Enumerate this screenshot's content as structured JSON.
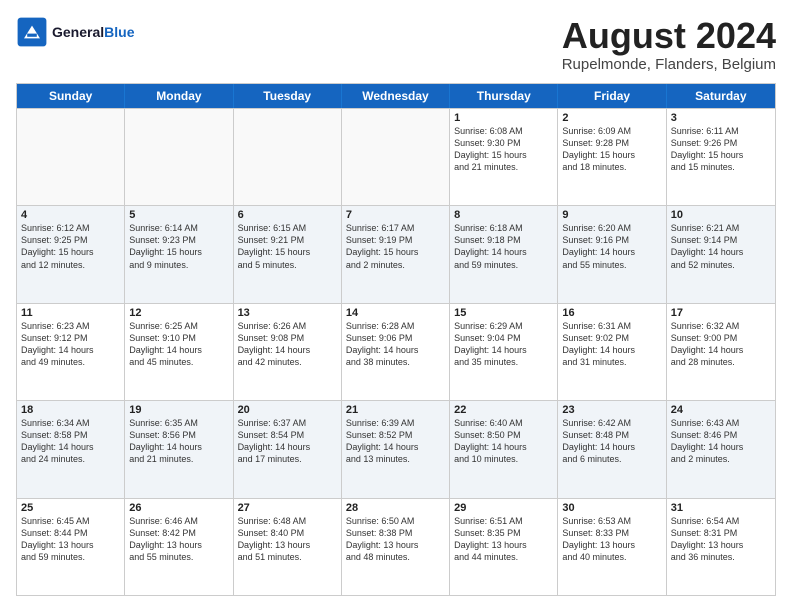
{
  "header": {
    "logo_line1": "General",
    "logo_line2": "Blue",
    "month_title": "August 2024",
    "subtitle": "Rupelmonde, Flanders, Belgium"
  },
  "days": [
    "Sunday",
    "Monday",
    "Tuesday",
    "Wednesday",
    "Thursday",
    "Friday",
    "Saturday"
  ],
  "rows": [
    [
      {
        "day": "",
        "text": ""
      },
      {
        "day": "",
        "text": ""
      },
      {
        "day": "",
        "text": ""
      },
      {
        "day": "",
        "text": ""
      },
      {
        "day": "1",
        "text": "Sunrise: 6:08 AM\nSunset: 9:30 PM\nDaylight: 15 hours\nand 21 minutes."
      },
      {
        "day": "2",
        "text": "Sunrise: 6:09 AM\nSunset: 9:28 PM\nDaylight: 15 hours\nand 18 minutes."
      },
      {
        "day": "3",
        "text": "Sunrise: 6:11 AM\nSunset: 9:26 PM\nDaylight: 15 hours\nand 15 minutes."
      }
    ],
    [
      {
        "day": "4",
        "text": "Sunrise: 6:12 AM\nSunset: 9:25 PM\nDaylight: 15 hours\nand 12 minutes."
      },
      {
        "day": "5",
        "text": "Sunrise: 6:14 AM\nSunset: 9:23 PM\nDaylight: 15 hours\nand 9 minutes."
      },
      {
        "day": "6",
        "text": "Sunrise: 6:15 AM\nSunset: 9:21 PM\nDaylight: 15 hours\nand 5 minutes."
      },
      {
        "day": "7",
        "text": "Sunrise: 6:17 AM\nSunset: 9:19 PM\nDaylight: 15 hours\nand 2 minutes."
      },
      {
        "day": "8",
        "text": "Sunrise: 6:18 AM\nSunset: 9:18 PM\nDaylight: 14 hours\nand 59 minutes."
      },
      {
        "day": "9",
        "text": "Sunrise: 6:20 AM\nSunset: 9:16 PM\nDaylight: 14 hours\nand 55 minutes."
      },
      {
        "day": "10",
        "text": "Sunrise: 6:21 AM\nSunset: 9:14 PM\nDaylight: 14 hours\nand 52 minutes."
      }
    ],
    [
      {
        "day": "11",
        "text": "Sunrise: 6:23 AM\nSunset: 9:12 PM\nDaylight: 14 hours\nand 49 minutes."
      },
      {
        "day": "12",
        "text": "Sunrise: 6:25 AM\nSunset: 9:10 PM\nDaylight: 14 hours\nand 45 minutes."
      },
      {
        "day": "13",
        "text": "Sunrise: 6:26 AM\nSunset: 9:08 PM\nDaylight: 14 hours\nand 42 minutes."
      },
      {
        "day": "14",
        "text": "Sunrise: 6:28 AM\nSunset: 9:06 PM\nDaylight: 14 hours\nand 38 minutes."
      },
      {
        "day": "15",
        "text": "Sunrise: 6:29 AM\nSunset: 9:04 PM\nDaylight: 14 hours\nand 35 minutes."
      },
      {
        "day": "16",
        "text": "Sunrise: 6:31 AM\nSunset: 9:02 PM\nDaylight: 14 hours\nand 31 minutes."
      },
      {
        "day": "17",
        "text": "Sunrise: 6:32 AM\nSunset: 9:00 PM\nDaylight: 14 hours\nand 28 minutes."
      }
    ],
    [
      {
        "day": "18",
        "text": "Sunrise: 6:34 AM\nSunset: 8:58 PM\nDaylight: 14 hours\nand 24 minutes."
      },
      {
        "day": "19",
        "text": "Sunrise: 6:35 AM\nSunset: 8:56 PM\nDaylight: 14 hours\nand 21 minutes."
      },
      {
        "day": "20",
        "text": "Sunrise: 6:37 AM\nSunset: 8:54 PM\nDaylight: 14 hours\nand 17 minutes."
      },
      {
        "day": "21",
        "text": "Sunrise: 6:39 AM\nSunset: 8:52 PM\nDaylight: 14 hours\nand 13 minutes."
      },
      {
        "day": "22",
        "text": "Sunrise: 6:40 AM\nSunset: 8:50 PM\nDaylight: 14 hours\nand 10 minutes."
      },
      {
        "day": "23",
        "text": "Sunrise: 6:42 AM\nSunset: 8:48 PM\nDaylight: 14 hours\nand 6 minutes."
      },
      {
        "day": "24",
        "text": "Sunrise: 6:43 AM\nSunset: 8:46 PM\nDaylight: 14 hours\nand 2 minutes."
      }
    ],
    [
      {
        "day": "25",
        "text": "Sunrise: 6:45 AM\nSunset: 8:44 PM\nDaylight: 13 hours\nand 59 minutes."
      },
      {
        "day": "26",
        "text": "Sunrise: 6:46 AM\nSunset: 8:42 PM\nDaylight: 13 hours\nand 55 minutes."
      },
      {
        "day": "27",
        "text": "Sunrise: 6:48 AM\nSunset: 8:40 PM\nDaylight: 13 hours\nand 51 minutes."
      },
      {
        "day": "28",
        "text": "Sunrise: 6:50 AM\nSunset: 8:38 PM\nDaylight: 13 hours\nand 48 minutes."
      },
      {
        "day": "29",
        "text": "Sunrise: 6:51 AM\nSunset: 8:35 PM\nDaylight: 13 hours\nand 44 minutes."
      },
      {
        "day": "30",
        "text": "Sunrise: 6:53 AM\nSunset: 8:33 PM\nDaylight: 13 hours\nand 40 minutes."
      },
      {
        "day": "31",
        "text": "Sunrise: 6:54 AM\nSunset: 8:31 PM\nDaylight: 13 hours\nand 36 minutes."
      }
    ]
  ]
}
